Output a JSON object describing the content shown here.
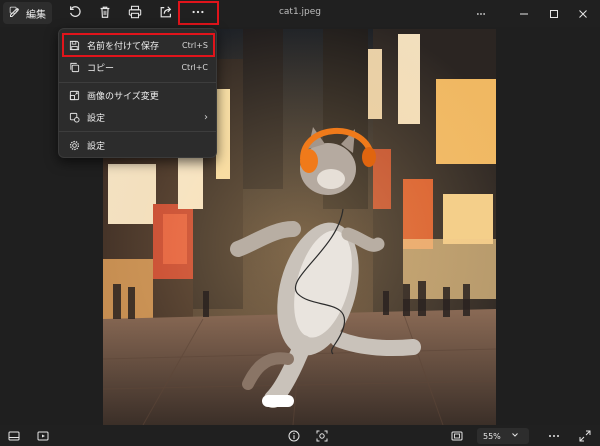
{
  "toolbar": {
    "edit_label": "編集",
    "icons": [
      "rotate-icon",
      "trash-icon",
      "print-icon",
      "share-icon",
      "more-icon"
    ]
  },
  "window": {
    "title": "cat1.jpeg"
  },
  "menu": {
    "items": [
      {
        "label": "名前を付けて保存",
        "shortcut": "Ctrl+S",
        "icon": "save-icon"
      },
      {
        "label": "コピー",
        "shortcut": "Ctrl+C",
        "icon": "copy-icon"
      },
      {
        "label": "画像のサイズ変更",
        "shortcut": "",
        "icon": "resize-icon"
      },
      {
        "label": "設定",
        "shortcut": "",
        "icon": "set-as-icon",
        "has_submenu": true
      },
      {
        "label": "設定",
        "shortcut": "",
        "icon": "gear-icon"
      }
    ]
  },
  "bottombar": {
    "zoom_value": "55%"
  },
  "colors": {
    "highlight": "#e1141b",
    "background": "#1f1f1f",
    "menu_bg": "#2c2c2c"
  }
}
